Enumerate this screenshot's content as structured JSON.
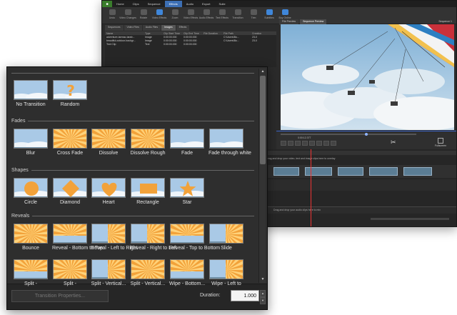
{
  "editor": {
    "menu": [
      "Home",
      "Clips",
      "Sequence",
      "Effects",
      "Audio",
      "Export",
      "Suite"
    ],
    "active_menu": "Effects",
    "ribbon": [
      {
        "label": "Undo",
        "icon": "undo-icon",
        "style": "gray"
      },
      {
        "label": "Video Changes",
        "icon": "video-changes-icon",
        "style": "gray"
      },
      {
        "label": "Rotate",
        "icon": "rotate-icon",
        "style": "gray"
      },
      {
        "label": "Video Effects",
        "icon": "video-effects-icon",
        "style": "hl"
      },
      {
        "label": "Zoom",
        "icon": "zoom-icon",
        "style": "gray"
      },
      {
        "label": "Video Effects",
        "icon": "fx-icon",
        "style": "gray"
      },
      {
        "label": "Audio Effects",
        "icon": "audio-effects-icon",
        "style": "gray"
      },
      {
        "label": "Text Effects",
        "icon": "text-effects-icon",
        "style": "gray"
      },
      {
        "label": "Transition",
        "icon": "transition-icon",
        "style": "gray"
      },
      {
        "label": "Trim",
        "icon": "trim-icon",
        "style": "gray"
      },
      {
        "label": "Subtitles",
        "icon": "subtitles-icon",
        "style": "hl"
      },
      {
        "label": "Buy Online",
        "icon": "buy-online-icon",
        "style": "hl"
      }
    ],
    "bin_tabs": [
      "Sequences",
      "Video Files",
      "Audio Files",
      "Images",
      "Effects"
    ],
    "selected_bin_tab": "Images",
    "file_columns": [
      "Name",
      "Type",
      "Clip Start Time",
      "Clip End Time",
      "File Duration",
      "File Path",
      "Creation"
    ],
    "files": [
      [
        "adventure-tarmac-tarab...",
        "Image",
        "0:00:00.000",
        "0:00:00.000",
        "",
        "C:\\Users\\Bo...",
        "23-0"
      ],
      [
        "beautiful-outdoor-backgr...",
        "Image",
        "0:00:00.000",
        "0:00:00.000",
        "",
        "C:\\Users\\Bo...",
        "23-0"
      ],
      [
        "Text Clip",
        "Text",
        "0:00:00.000",
        "0:00:00.000",
        "",
        "",
        ""
      ]
    ],
    "preview_tabs": [
      "File Preview",
      "Sequence Preview"
    ],
    "selected_preview_tab": "Sequence Preview",
    "preview_title": "Sequence 1",
    "timecode": "0:00:12.377",
    "fullscreen_label": "Fullscreen",
    "timeline_hint": "Drag and drop your video, text and image clips here to overlay",
    "audio_hint": "Drag and drop your audio clips here to mix"
  },
  "panel": {
    "top_tiles": [
      {
        "label": "No Transition",
        "icon": "no-transition-icon",
        "kind": "plain"
      },
      {
        "label": "Random",
        "icon": "random-question-icon",
        "kind": "question"
      }
    ],
    "sections": [
      {
        "title": "Fades",
        "items": [
          {
            "label": "Blur",
            "kind": "plain"
          },
          {
            "label": "Cross Fade",
            "kind": "rays"
          },
          {
            "label": "Dissolve",
            "kind": "rays"
          },
          {
            "label": "Dissolve Rough",
            "kind": "rays"
          },
          {
            "label": "Fade",
            "kind": "plain"
          },
          {
            "label": "Fade through white",
            "kind": "plain"
          }
        ]
      },
      {
        "title": "Shapes",
        "items": [
          {
            "label": "Circle",
            "kind": "circle"
          },
          {
            "label": "Diamond",
            "kind": "diamond"
          },
          {
            "label": "Heart",
            "kind": "heart"
          },
          {
            "label": "Rectangle",
            "kind": "rect"
          },
          {
            "label": "Star",
            "kind": "star"
          }
        ]
      },
      {
        "title": "Reveals",
        "items": [
          {
            "label": "Bounce",
            "kind": "rays"
          },
          {
            "label": "Reveal - Bottom to Top",
            "kind": "split-h"
          },
          {
            "label": "Reveal - Left to Right",
            "kind": "split-v"
          },
          {
            "label": "Reveal - Right to Left",
            "kind": "split-v"
          },
          {
            "label": "Reveal - Top to Bottom",
            "kind": "split-h"
          },
          {
            "label": "Slide",
            "kind": "split-v"
          },
          {
            "label": "Split -",
            "kind": "split-h"
          },
          {
            "label": "Split -",
            "kind": "rays"
          },
          {
            "label": "Split - Vertical...",
            "kind": "split-v"
          },
          {
            "label": "Split - Vertical...",
            "kind": "rays"
          },
          {
            "label": "Wipe - Bottom...",
            "kind": "split-h"
          },
          {
            "label": "Wipe - Left to",
            "kind": "split-v"
          }
        ]
      }
    ],
    "transition_properties_label": "Transition Properties...",
    "duration_label": "Duration:",
    "duration_value": "1.000"
  },
  "colors": {
    "accent": "#3c6fb4",
    "sky": "#a9c9e6",
    "sun": "#f2a23a",
    "sun_light": "#ffd27a",
    "panel_bg": "#2e2e2e"
  }
}
